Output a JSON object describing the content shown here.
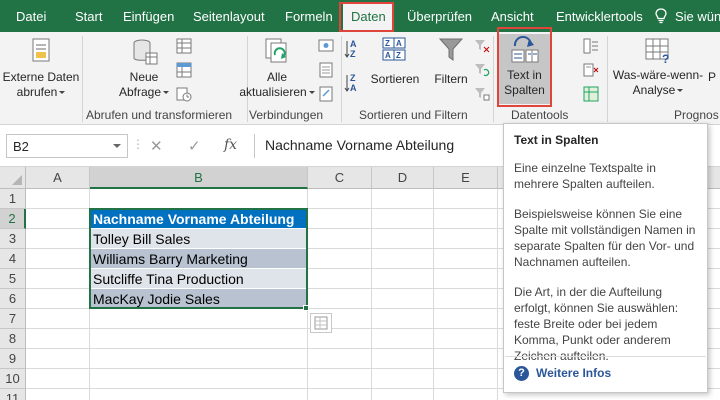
{
  "colors": {
    "excel_green": "#217346",
    "highlight_red": "#e0453c",
    "table_header_blue": "#0070c0",
    "band_light": "#dfe3ea",
    "band_dark": "#b9c2d0",
    "help_blue": "#2b579a"
  },
  "menu": {
    "tabs": [
      "Datei",
      "Start",
      "Einfügen",
      "Seitenlayout",
      "Formeln",
      "Daten",
      "Überprüfen",
      "Ansicht",
      "Entwicklertools"
    ],
    "active_tab": "Daten",
    "tellme_text": "Sie wün",
    "tellme_icon": "lightbulb-icon"
  },
  "ribbon": {
    "externe_daten": {
      "line1": "Externe Daten",
      "line2": "abrufen"
    },
    "neue_abfrage": {
      "line1": "Neue",
      "line2": "Abfrage"
    },
    "alle_aktualisieren": {
      "line1": "Alle",
      "line2": "aktualisieren"
    },
    "sortieren": "Sortieren",
    "filtern": "Filtern",
    "text_in_spalten": {
      "line1": "Text in",
      "line2": "Spalten"
    },
    "was_waere_wenn": {
      "line1": "Was-wäre-wenn-",
      "line2": "Analyse"
    },
    "groups": {
      "abrufen": "Abrufen und transformieren",
      "verbindungen": "Verbindungen",
      "sortieren_filtern": "Sortieren und Filtern",
      "datentools": "Datentools",
      "prognose": "Prognos"
    }
  },
  "formula_bar": {
    "name_box": "B2",
    "fx_label": "fx",
    "cancel_symbol": "✕",
    "enter_symbol": "✓",
    "formula": "Nachname Vorname Abteilung"
  },
  "grid": {
    "columns": [
      "A",
      "B",
      "C",
      "D",
      "E"
    ],
    "rows": [
      "1",
      "2",
      "3",
      "4",
      "5",
      "6",
      "7",
      "8",
      "9",
      "10",
      "11"
    ],
    "selected_column": "B",
    "selected_cell": "B2",
    "cells": [
      "Nachname Vorname Abteilung",
      "Tolley Bill Sales",
      "Williams Barry Marketing",
      "Sutcliffe Tina Production",
      "MacKay Jodie Sales"
    ]
  },
  "tooltip": {
    "title": "Text in Spalten",
    "p1": "Eine einzelne Textspalte in mehrere Spalten aufteilen.",
    "p2": "Beispielsweise können Sie eine Spalte mit vollständigen Namen in separate Spalten für den Vor- und Nachnamen aufteilen.",
    "p3": "Die Art, in der die Aufteilung erfolgt, können Sie auswählen: feste Breite oder bei jedem Komma, Punkt oder anderem Zeichen aufteilen.",
    "more": "Weitere Infos",
    "more_icon": "help-icon"
  }
}
